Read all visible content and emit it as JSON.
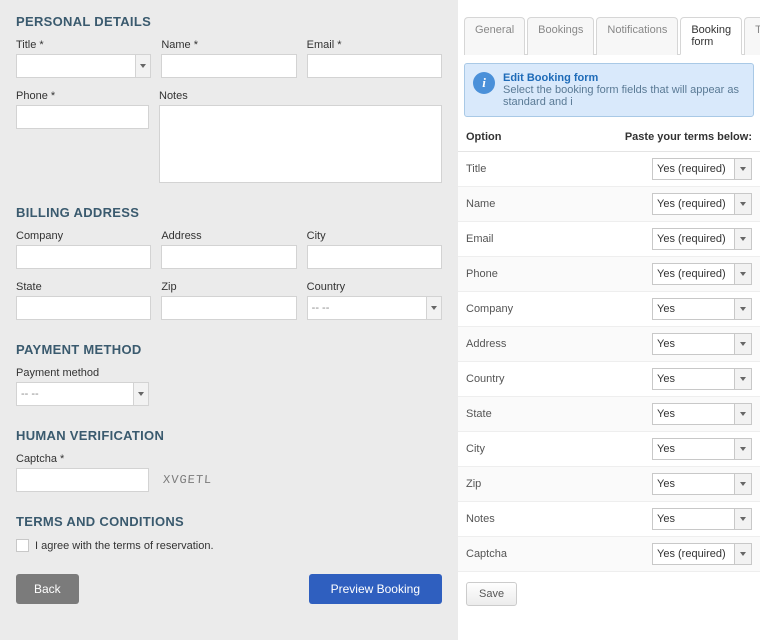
{
  "left": {
    "sections": {
      "personal": {
        "title": "PERSONAL DETAILS",
        "title_label": "Title *",
        "name_label": "Name *",
        "email_label": "Email *",
        "phone_label": "Phone *",
        "notes_label": "Notes"
      },
      "billing": {
        "title": "BILLING ADDRESS",
        "company_label": "Company",
        "address_label": "Address",
        "city_label": "City",
        "state_label": "State",
        "zip_label": "Zip",
        "country_label": "Country",
        "country_value": "-- --"
      },
      "payment": {
        "title": "PAYMENT METHOD",
        "method_label": "Payment method",
        "method_value": "-- --"
      },
      "verification": {
        "title": "HUMAN VERIFICATION",
        "captcha_label": "Captcha *",
        "captcha_image_text": "XVGETL"
      },
      "terms": {
        "title": "TERMS AND CONDITIONS",
        "checkbox_label": "I agree with the terms of reservation."
      }
    },
    "buttons": {
      "back": "Back",
      "preview": "Preview Booking"
    }
  },
  "right": {
    "tabs": {
      "general": "General",
      "bookings": "Bookings",
      "notifications": "Notifications",
      "booking_form": "Booking form",
      "terms": "Terms"
    },
    "info": {
      "title": "Edit Booking form",
      "subtitle": "Select the booking form fields that will appear as standard and i"
    },
    "header": {
      "option": "Option",
      "value": "Paste your terms below:"
    },
    "options": [
      {
        "label": "Title",
        "value": "Yes (required)"
      },
      {
        "label": "Name",
        "value": "Yes (required)"
      },
      {
        "label": "Email",
        "value": "Yes (required)"
      },
      {
        "label": "Phone",
        "value": "Yes (required)"
      },
      {
        "label": "Company",
        "value": "Yes"
      },
      {
        "label": "Address",
        "value": "Yes"
      },
      {
        "label": "Country",
        "value": "Yes"
      },
      {
        "label": "State",
        "value": "Yes"
      },
      {
        "label": "City",
        "value": "Yes"
      },
      {
        "label": "Zip",
        "value": "Yes"
      },
      {
        "label": "Notes",
        "value": "Yes"
      },
      {
        "label": "Captcha",
        "value": "Yes (required)"
      }
    ],
    "save": "Save"
  }
}
